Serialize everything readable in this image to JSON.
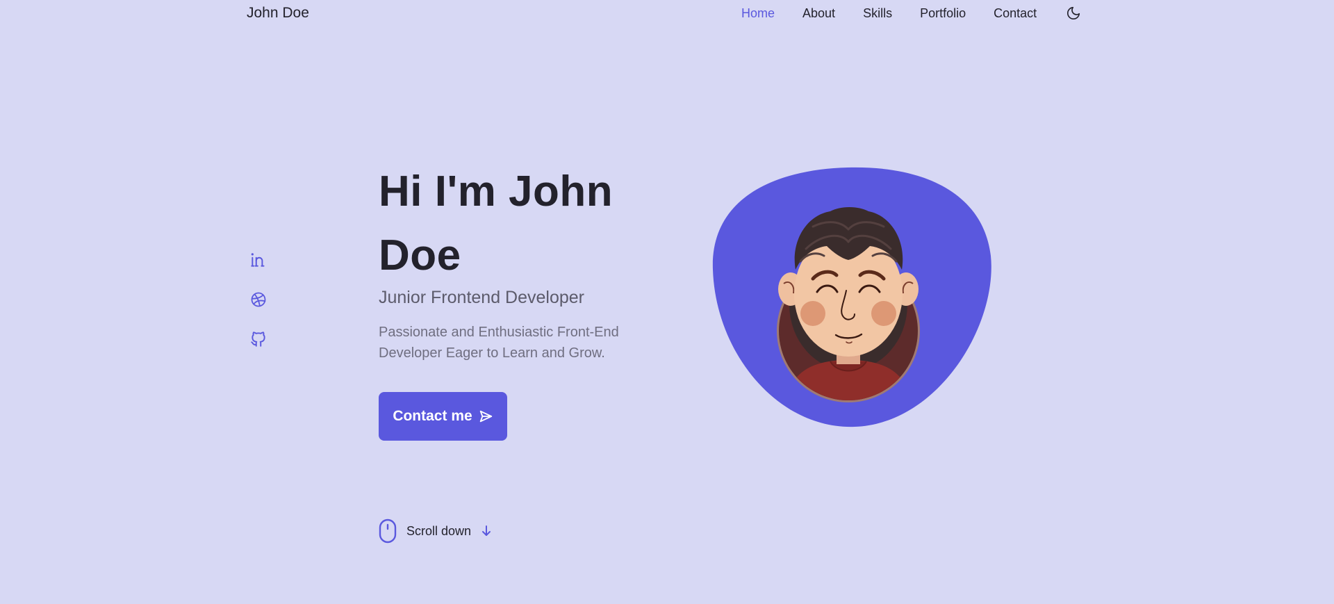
{
  "header": {
    "brand": "John Doe",
    "nav": [
      {
        "label": "Home",
        "active": true
      },
      {
        "label": "About",
        "active": false
      },
      {
        "label": "Skills",
        "active": false
      },
      {
        "label": "Portfolio",
        "active": false
      },
      {
        "label": "Contact",
        "active": false
      }
    ],
    "theme_toggle_icon": "moon-icon"
  },
  "social": [
    "linkedin-icon",
    "dribbble-icon",
    "github-icon"
  ],
  "hero": {
    "title": "Hi I'm John Doe",
    "subtitle": "Junior Frontend Developer",
    "description": "Passionate and Enthusiastic Front-End Developer Eager to Learn and Grow.",
    "cta_label": "Contact me",
    "cta_icon": "send-icon"
  },
  "scroll": {
    "label": "Scroll down",
    "icons": [
      "mouse-icon",
      "arrow-down-icon"
    ]
  },
  "colors": {
    "background": "#d7d8f4",
    "accent": "#5a58de",
    "title": "#23222c",
    "text": "#6f6e80"
  }
}
